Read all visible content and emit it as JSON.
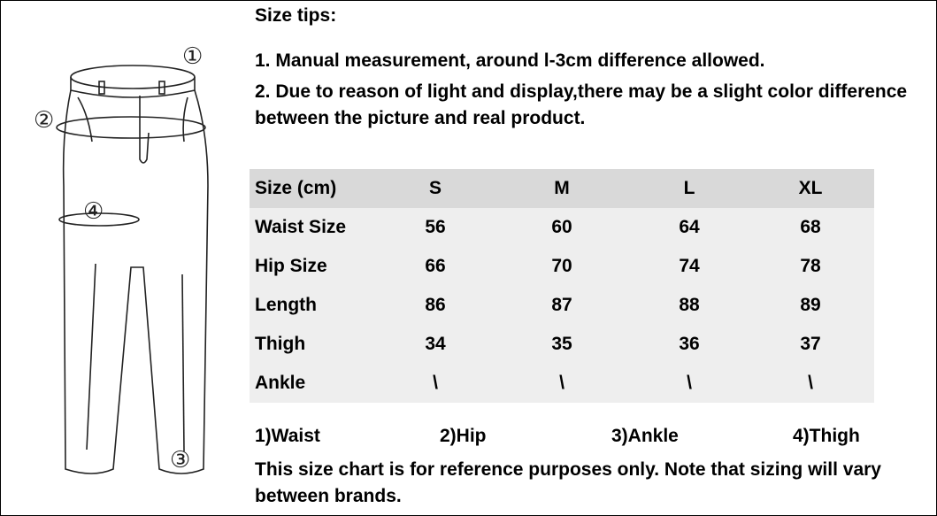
{
  "tips": {
    "title": "Size tips:",
    "tip1": "1. Manual measurement, around l-3cm difference allowed.",
    "tip2": "2. Due to reason of light and display,there may be a slight color difference between the picture and real product."
  },
  "diagram": {
    "markers": [
      "①",
      "②",
      "③",
      "④"
    ]
  },
  "table": {
    "header": [
      "Size (cm)",
      "S",
      "M",
      "L",
      "XL"
    ],
    "rows": [
      [
        "Waist Size",
        "56",
        "60",
        "64",
        "68"
      ],
      [
        "Hip Size",
        "66",
        "70",
        "74",
        "78"
      ],
      [
        "Length",
        "86",
        "87",
        "88",
        "89"
      ],
      [
        "Thigh",
        "34",
        "35",
        "36",
        "37"
      ],
      [
        "Ankle",
        "\\",
        "\\",
        "\\",
        "\\"
      ]
    ]
  },
  "legend": [
    "1)Waist",
    "2)Hip",
    "3)Ankle",
    "4)Thigh"
  ],
  "note": "This size chart is for reference purposes only. Note that sizing will vary between brands."
}
